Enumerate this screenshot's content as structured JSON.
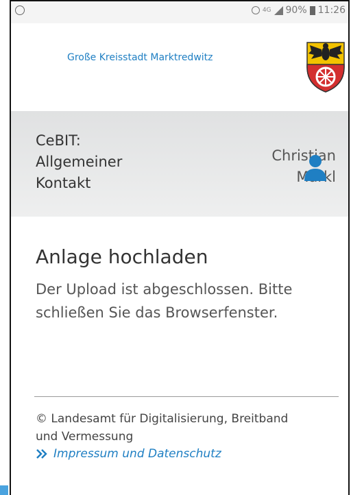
{
  "statusbar": {
    "network": "4G",
    "battery": "90%",
    "time": "11:26"
  },
  "header": {
    "city_name": "Große Kreisstadt Marktredwitz",
    "logo_icon": "coat-of-arms-icon"
  },
  "userbar": {
    "contact_title": "CeBIT: Allgemeiner Kontakt",
    "user_name": "Christian Markl",
    "user_icon": "user-icon"
  },
  "main": {
    "heading": "Anlage hochladen",
    "message": "Der Upload ist abgeschlossen. Bitte schließen Sie das Browserfenster."
  },
  "footer": {
    "copyright": "© Landesamt für Digitalisierung, Breitband und Vermessung",
    "impressum_link": "Impressum und Datenschutz"
  },
  "colors": {
    "link": "#1f7fc3",
    "userbar_bg": "#e6e7e8",
    "text": "#333333"
  }
}
